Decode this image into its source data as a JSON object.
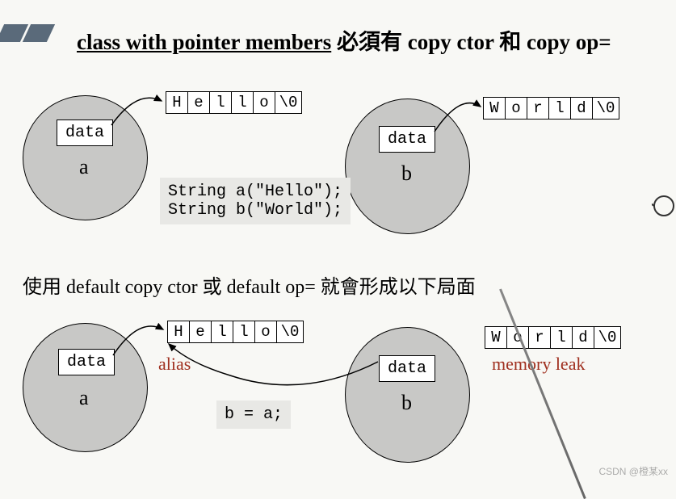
{
  "title": {
    "underlined": "class with pointer members",
    "rest": " 必須有 copy ctor 和 copy op="
  },
  "top": {
    "a": {
      "data_label": "data",
      "obj_label": "a",
      "chars": [
        "H",
        "e",
        "l",
        "l",
        "o",
        "\\0"
      ]
    },
    "b": {
      "data_label": "data",
      "obj_label": "b",
      "chars": [
        "W",
        "o",
        "r",
        "l",
        "d",
        "\\0"
      ]
    },
    "code": "String a(\"Hello\");\nString b(\"World\");"
  },
  "midtext": "使用 default copy ctor 或 default op= 就會形成以下局面",
  "bottom": {
    "a": {
      "data_label": "data",
      "obj_label": "a",
      "chars": [
        "H",
        "e",
        "l",
        "l",
        "o",
        "\\0"
      ]
    },
    "b": {
      "data_label": "data",
      "obj_label": "b"
    },
    "orphan_chars": [
      "W",
      "o",
      "r",
      "l",
      "d",
      "\\0"
    ],
    "alias_label": "alias",
    "leak_label": "memory leak",
    "code": "b = a;"
  },
  "watermark": "CSDN @橙某xx"
}
